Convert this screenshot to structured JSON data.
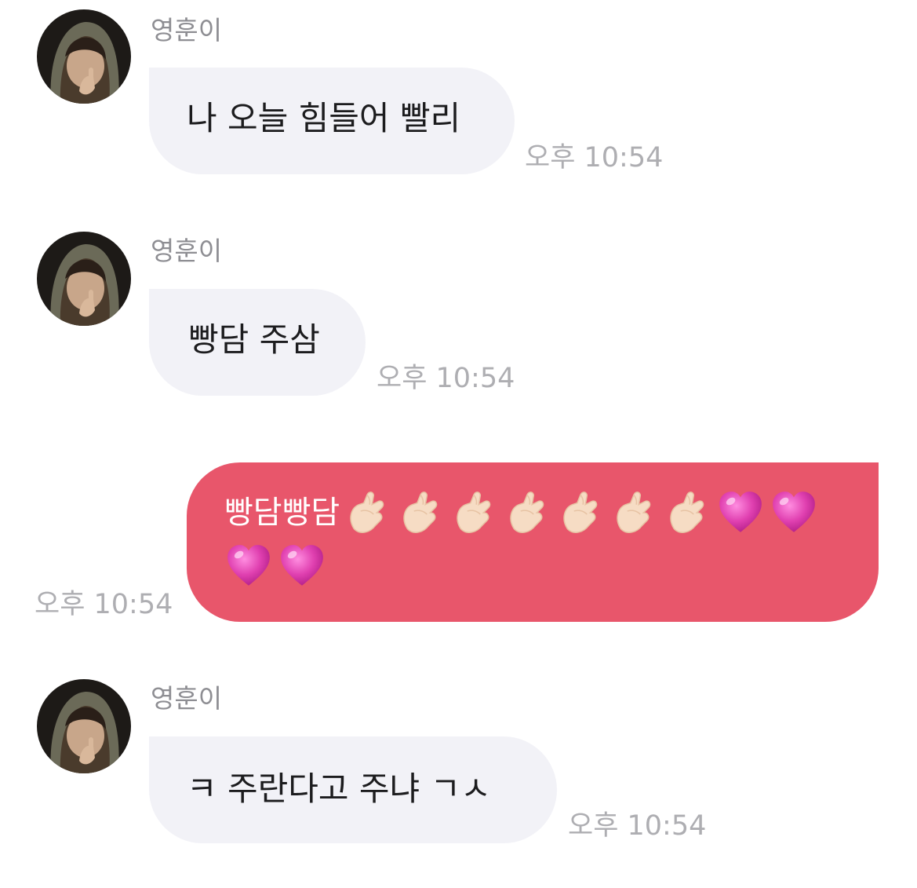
{
  "chat": {
    "messages": [
      {
        "direction": "incoming",
        "sender": "영훈이",
        "avatar": "avatar-photo",
        "text": "나 오늘 힘들어 빨리",
        "time": "오후 10:54"
      },
      {
        "direction": "incoming",
        "sender": "영훈이",
        "avatar": "avatar-photo",
        "text": "빵담 주삼",
        "time": "오후 10:54"
      },
      {
        "direction": "outgoing",
        "text": "빵담빵담",
        "emoji": [
          "finger-heart",
          "finger-heart",
          "finger-heart",
          "finger-heart",
          "finger-heart",
          "finger-heart",
          "finger-heart",
          "heart",
          "heart",
          "heart",
          "heart"
        ],
        "time": "오후 10:54"
      },
      {
        "direction": "incoming",
        "sender": "영훈이",
        "avatar": "avatar-photo",
        "text": "ㅋ 주란다고 주냐 ㄱㅅ",
        "time": "오후 10:54"
      }
    ]
  },
  "colors": {
    "incoming_bubble": "#f2f2f7",
    "outgoing_bubble": "#e8566b",
    "timestamp": "#aeaeb2",
    "sender_name": "#8e8e93",
    "heart": "#e040b0"
  }
}
